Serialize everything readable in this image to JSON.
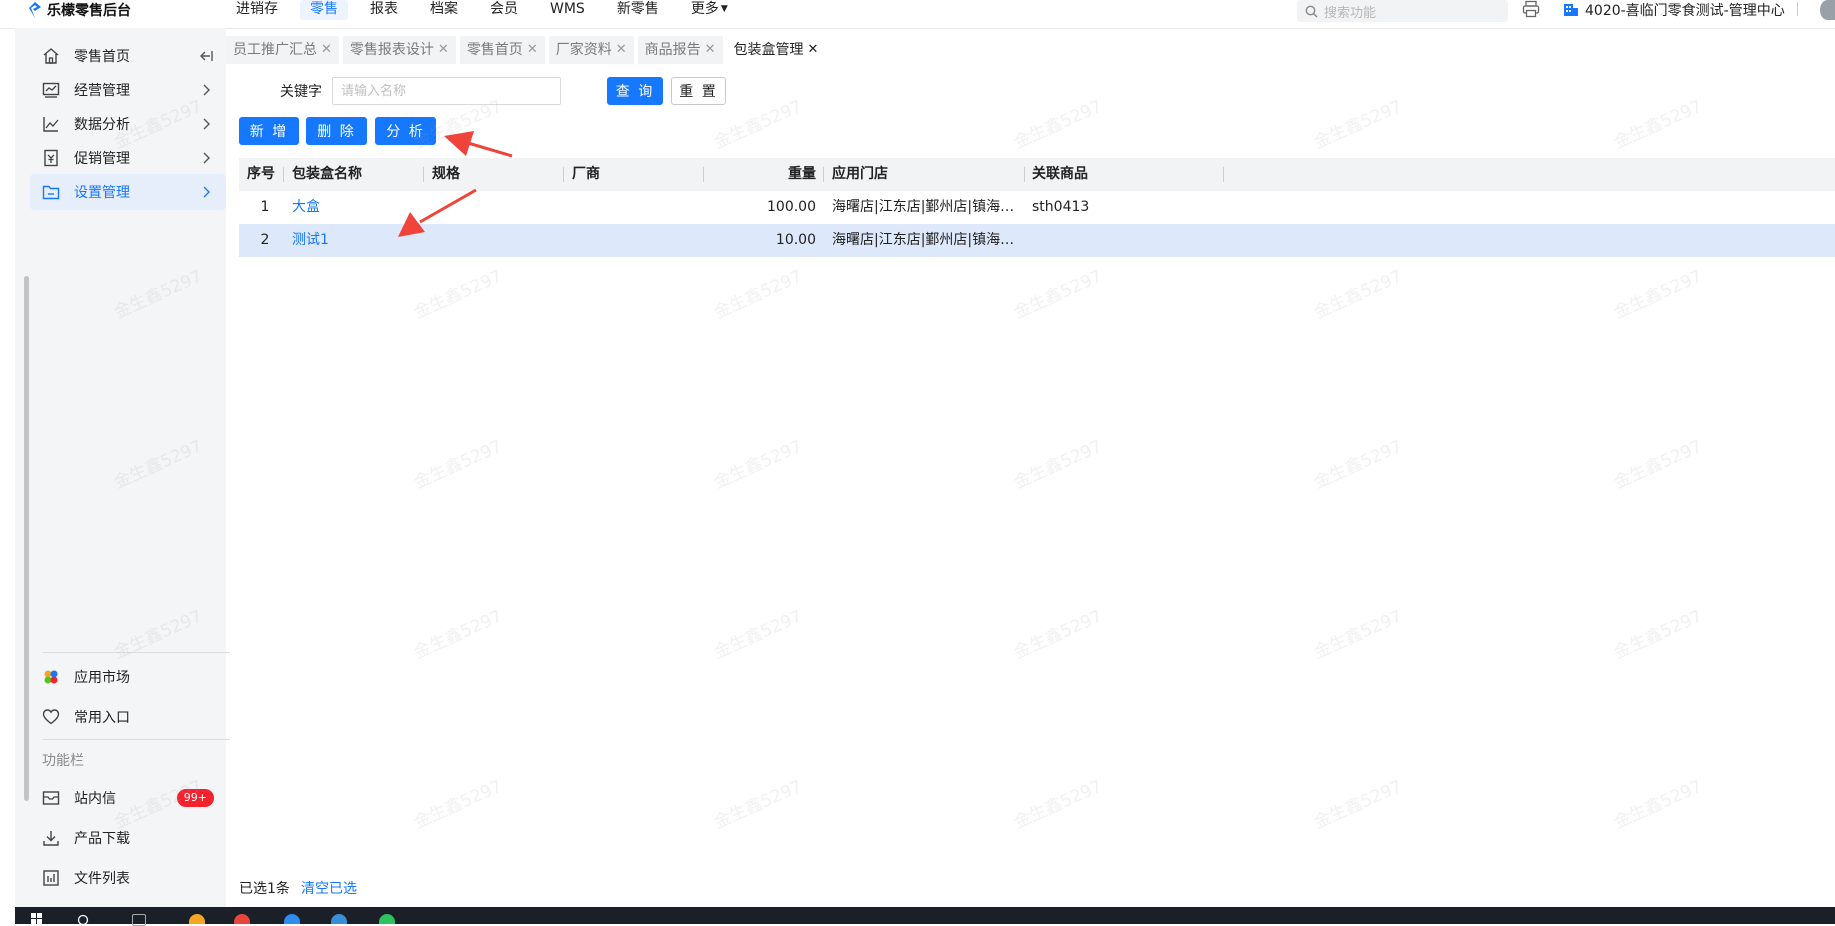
{
  "app": {
    "brand": "乐檬零售后台",
    "brand_color": "#1677ff",
    "accent_color": "#1677ff"
  },
  "top_nav": {
    "items": [
      "进销存",
      "零售",
      "报表",
      "档案",
      "会员",
      "WMS",
      "新零售",
      "更多"
    ],
    "active_index": 1
  },
  "search": {
    "placeholder": "搜索功能"
  },
  "org": {
    "name": "4020-喜临门零食测试-管理中心"
  },
  "sidebar": {
    "items": [
      {
        "label": "零售首页",
        "icon": "home-icon"
      },
      {
        "label": "经营管理",
        "icon": "business-chart-icon"
      },
      {
        "label": "数据分析",
        "icon": "line-chart-icon"
      },
      {
        "label": "促销管理",
        "icon": "coupon-icon"
      },
      {
        "label": "设置管理",
        "icon": "folder-settings-icon",
        "active": true
      }
    ],
    "bottom_items": [
      {
        "label": "应用市场",
        "icon": "app-market-icon"
      },
      {
        "label": "常用入口",
        "icon": "heart-icon"
      }
    ],
    "section_label": "功能栏",
    "tool_items": [
      {
        "label": "站内信",
        "icon": "mail-icon",
        "badge": "99+"
      },
      {
        "label": "产品下载",
        "icon": "download-icon"
      },
      {
        "label": "文件列表",
        "icon": "file-list-icon"
      }
    ]
  },
  "tabs": [
    {
      "label": "员工推广汇总"
    },
    {
      "label": "零售报表设计"
    },
    {
      "label": "零售首页"
    },
    {
      "label": "厂家资料"
    },
    {
      "label": "商品报告"
    },
    {
      "label": "包装盒管理",
      "active": true
    }
  ],
  "filter": {
    "keyword_label": "关键字",
    "keyword_placeholder": "请输入名称",
    "keyword_value": "",
    "query_button": "查 询",
    "reset_button": "重 置"
  },
  "toolbar": {
    "add_button": "新 增",
    "delete_button": "删 除",
    "analyze_button": "分 析"
  },
  "table": {
    "columns": [
      "序号",
      "包装盒名称",
      "规格",
      "厂商",
      "重量",
      "应用门店",
      "关联商品"
    ],
    "rows": [
      {
        "index": "1",
        "name": "大盒",
        "spec": "",
        "vendor": "",
        "weight": "100.00",
        "stores": "海曙店|江东店|鄞州店|镇海…",
        "product": "sth0413",
        "selected": false
      },
      {
        "index": "2",
        "name": "测试1",
        "spec": "",
        "vendor": "",
        "weight": "10.00",
        "stores": "海曙店|江东店|鄞州店|镇海…",
        "product": "",
        "selected": true
      }
    ]
  },
  "footer": {
    "selected_text": "已选1条",
    "clear_link": "清空已选"
  },
  "watermark": {
    "text": "金生鑫5297"
  }
}
